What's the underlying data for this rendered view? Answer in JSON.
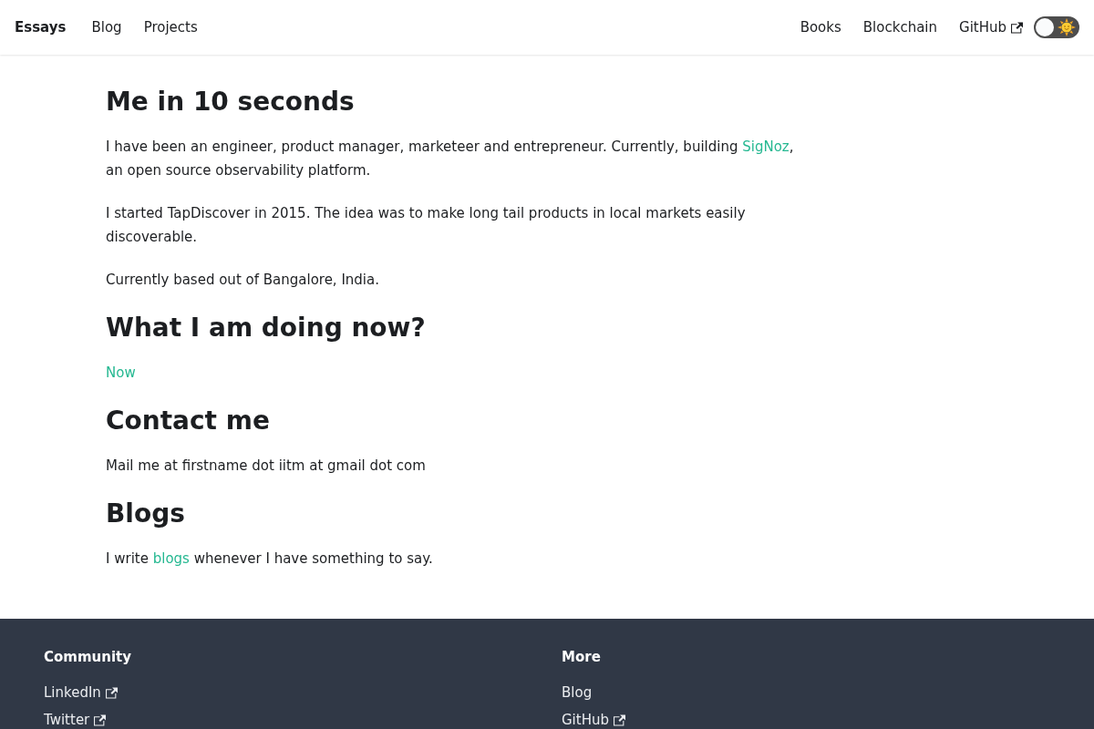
{
  "navbar": {
    "brand": "Essays",
    "left_links": [
      {
        "label": "Blog",
        "external": false
      },
      {
        "label": "Projects",
        "external": false
      }
    ],
    "right_links": [
      {
        "label": "Books",
        "external": false
      },
      {
        "label": "Blockchain",
        "external": false
      },
      {
        "label": "GitHub",
        "external": true
      }
    ],
    "theme_toggle": {
      "on": false
    }
  },
  "sections": [
    {
      "heading": "Me in 10 seconds",
      "paragraphs": [
        [
          {
            "kind": "text",
            "text": "I have been an engineer, product manager, marketeer and entrepreneur. Currently, building "
          },
          {
            "kind": "link",
            "text": "SigNoz"
          },
          {
            "kind": "text",
            "text": ", an open source observability platform."
          }
        ],
        [
          {
            "kind": "text",
            "text": "I started TapDiscover in 2015. The idea was to make long tail products in local markets easily discoverable."
          }
        ],
        [
          {
            "kind": "text",
            "text": "Currently based out of Bangalore, India."
          }
        ]
      ]
    },
    {
      "heading": "What I am doing now?",
      "paragraphs": [
        [
          {
            "kind": "link",
            "text": "Now"
          }
        ]
      ]
    },
    {
      "heading": "Contact me",
      "paragraphs": [
        [
          {
            "kind": "text",
            "text": "Mail me at firstname dot iitm at gmail dot com"
          }
        ]
      ]
    },
    {
      "heading": "Blogs",
      "paragraphs": [
        [
          {
            "kind": "text",
            "text": "I write "
          },
          {
            "kind": "link",
            "text": "blogs"
          },
          {
            "kind": "text",
            "text": " whenever I have something to say."
          }
        ]
      ]
    }
  ],
  "footer": {
    "columns": [
      {
        "title": "Community",
        "links": [
          {
            "label": "LinkedIn",
            "external": true
          },
          {
            "label": "Twitter",
            "external": true
          }
        ]
      },
      {
        "title": "More",
        "links": [
          {
            "label": "Blog",
            "external": false
          },
          {
            "label": "GitHub",
            "external": true
          }
        ]
      }
    ]
  }
}
